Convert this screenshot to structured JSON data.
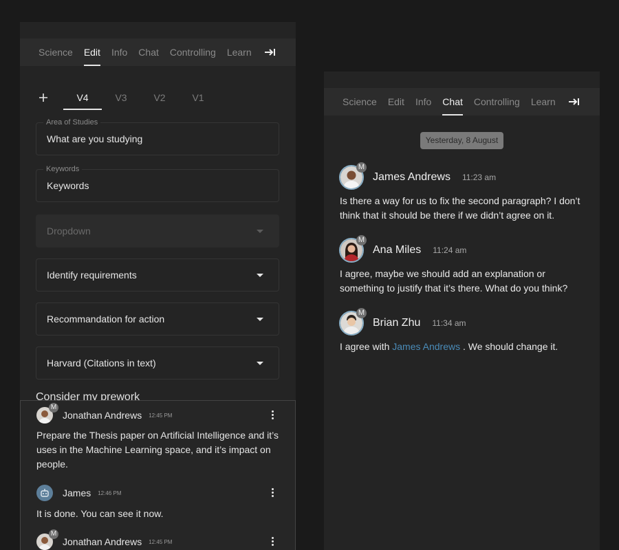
{
  "tabs": [
    "Science",
    "Edit",
    "Info",
    "Chat",
    "Controlling",
    "Learn"
  ],
  "left_panel": {
    "active_tab": "Edit",
    "version_tabs": [
      "V4",
      "V3",
      "V2",
      "V1"
    ],
    "active_version": "V4",
    "fields": {
      "area": {
        "label": "Area of Studies",
        "value": "What are you studying"
      },
      "keywords": {
        "label": "Keywords",
        "value": "Keywords"
      },
      "dropdown": {
        "value": "Dropdown"
      },
      "requirements": {
        "value": "Identify requirements"
      },
      "recommendation": {
        "value": "Recommandation for action"
      },
      "citation": {
        "value": "Harvard (Citations in text)"
      }
    },
    "section_title": "Consider my prework",
    "comments": [
      {
        "name": "Jonathan Andrews",
        "badge": "M",
        "time": "12:45 PM",
        "text": "Prepare the Thesis paper on Artificial Intelligence and it’s uses in the Machine Learning space, and it’s impact on people."
      },
      {
        "name": "James",
        "time": "12:46 PM",
        "text": "It is done. You can see it now."
      },
      {
        "name": "Jonathan Andrews",
        "badge": "M",
        "time": "12:45 PM"
      }
    ]
  },
  "right_panel": {
    "active_tab": "Chat",
    "date_chip": "Yesterday, 8 August",
    "messages": [
      {
        "name": "James Andrews",
        "badge": "M",
        "time": "11:23 am",
        "text": "Is there a way for us to fix the second paragraph? I don’t think that it should be there if we didn’t agree on it."
      },
      {
        "name": "Ana Miles",
        "badge": "M",
        "time": "11:24 am",
        "text": "I agree, maybe we should add an explanation or something to justify that it’s there. What do you think?"
      },
      {
        "name": "Brian Zhu",
        "badge": "M",
        "time": "11:34 am",
        "text_before": "I agree with",
        "mention": "James Andrews",
        "text_after": ". We should change it."
      }
    ]
  },
  "colors": {
    "background": "#1a1a1a",
    "panel": "#242424",
    "tabbar": "#2c2c2c",
    "mention": "#4a8bb8",
    "bot_avatar": "#5d7f9a"
  }
}
